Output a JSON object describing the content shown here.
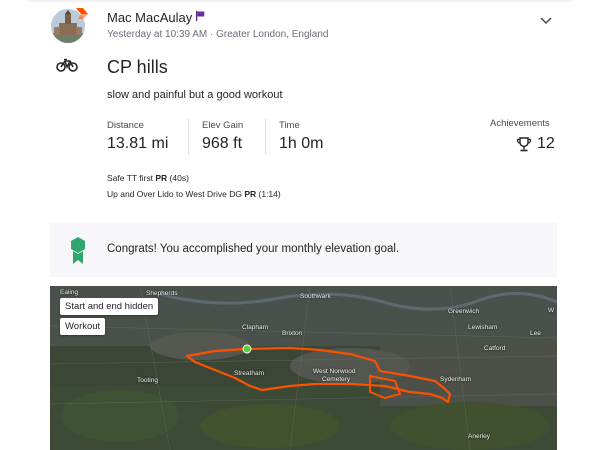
{
  "header": {
    "athlete_name": "Mac MacAulay",
    "meta": "Yesterday at 10:39 AM · Greater London, England"
  },
  "activity": {
    "type_icon": "bike-icon",
    "title": "CP hills",
    "description": "slow and painful but a good workout"
  },
  "stats": [
    {
      "label": "Distance",
      "value": "13.81 mi"
    },
    {
      "label": "Elev Gain",
      "value": "968 ft"
    },
    {
      "label": "Time",
      "value": "1h 0m"
    }
  ],
  "achievements": {
    "label": "Achievements",
    "value": "12"
  },
  "prs": [
    {
      "segment": "Safe TT first",
      "badge": "PR",
      "time": "(40s)"
    },
    {
      "segment": "Up and Over Lido to West Drive DG",
      "badge": "PR",
      "time": "(1:14)"
    }
  ],
  "goal_banner": {
    "text": "Congrats! You accomplished your monthly elevation goal."
  },
  "map": {
    "chips": {
      "start_end": "Start and end hidden",
      "workout": "Workout"
    },
    "labels": {
      "ealing": "Ealing",
      "shepherds": "Shepherds",
      "southwark": "Southwark",
      "greenwich": "Greenwich",
      "lewisham": "Lewisham",
      "lee": "Lee",
      "clapham": "Clapham",
      "brixton": "Brixton",
      "catford": "Catford",
      "tooting": "Tooting",
      "streatham": "Streatham",
      "west_norwood": "West Norwood",
      "cemetery": "Cemetery",
      "sydenham": "Sydenham",
      "anerley": "Anerley",
      "w_edge": "W"
    },
    "route_color": "#fc5200"
  },
  "colors": {
    "accent": "#fc5200",
    "goal_icon": "#2fa56f",
    "text": "#242428",
    "muted": "#6d6d78"
  }
}
